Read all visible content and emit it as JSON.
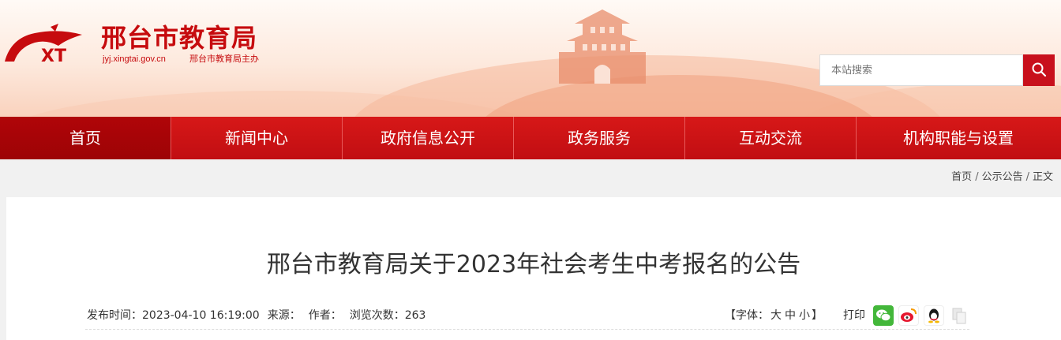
{
  "header": {
    "site_name": "邢台市教育局",
    "domain": "jyj.xingtai.gov.cn",
    "host": "邢台市教育局主办",
    "logo_letters": "XT",
    "search_placeholder": "本站搜索"
  },
  "nav": {
    "items": [
      {
        "label": "首页"
      },
      {
        "label": "新闻中心"
      },
      {
        "label": "政府信息公开"
      },
      {
        "label": "政务服务"
      },
      {
        "label": "互动交流"
      },
      {
        "label": "机构职能与设置"
      }
    ],
    "active_index": 0
  },
  "breadcrumb": {
    "items": [
      "首页",
      "公示公告",
      "正文"
    ],
    "separator": "/"
  },
  "article": {
    "title": "邢台市教育局关于2023年社会考生中考报名的公告",
    "publish_time": "发布时间：2023-04-10 16:19:00",
    "source": "来源：",
    "author": "作者：",
    "views": "浏览次数：263",
    "font_size_prefix": "【字体：",
    "font_large": "大",
    "font_medium": "中",
    "font_small": "小",
    "font_size_suffix": "】",
    "print": "打印"
  },
  "share": {
    "icons": [
      "wechat-icon",
      "weibo-icon",
      "qq-icon",
      "copy-icon"
    ]
  },
  "colors": {
    "brand_red": "#c60b0e",
    "nav_red": "#d71818",
    "nav_active": "#a40407"
  }
}
